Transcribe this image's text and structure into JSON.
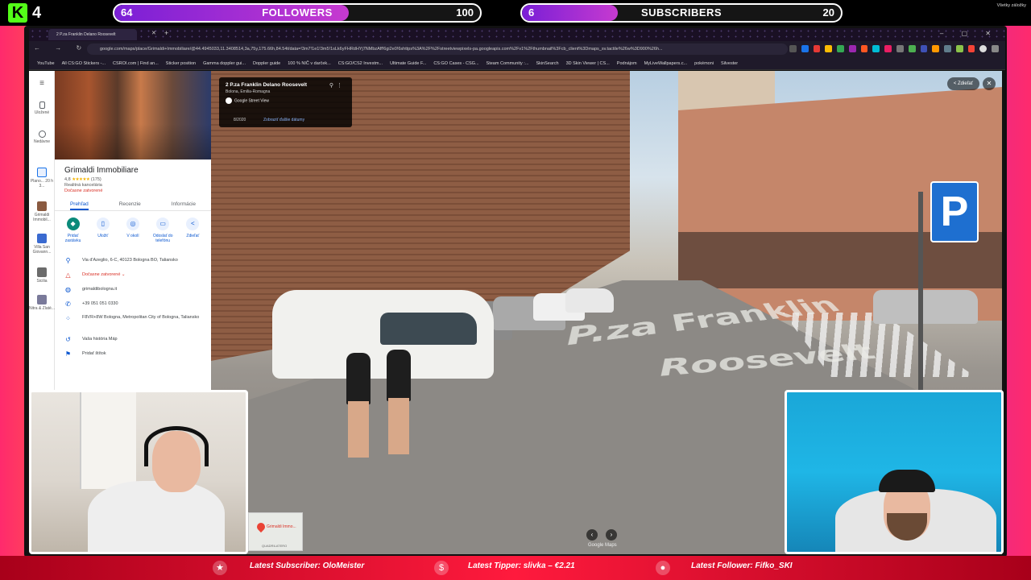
{
  "overlay": {
    "kick_count": "4",
    "followers_goal": {
      "current": "64",
      "label": "FOLLOWERS",
      "target": "100",
      "progress": 0.64
    },
    "subscribers_goal": {
      "current": "6",
      "label": "SUBSCRIBERS",
      "target": "20",
      "progress": 0.3
    }
  },
  "browser": {
    "tab_title": "2 P.za Franklin Delano Roosevelt",
    "url": "google.com/maps/place/Grimaldi+Immobiliare/@44.4945033,11.3408514,3a,75y,175.66h,84.54t/data=!3m7!1e1!3m5!1sLk6yFHRdHYj7NMbzAff!6gi2e0!6shttps%3A%2F%2Fstreetviewpixels-pa.googleapis.com%2Fv1%2Fthumbnail%3Fcb_client%3Dmaps_sv.tactile%26w%3D900%26h...",
    "bookmarks": [
      "YouTube",
      "All CS:GO Stickers -...",
      "CSROI.com | Find an...",
      "Sticker position",
      "Gamma doppler gui...",
      "Doppler guide",
      "100 % NIČ v darček...",
      "CS:GO/CS2 Investm...",
      "Ultimate Guide F...",
      "CS:GO Cases - CSG...",
      "Steam Community :...",
      "SkinSearch",
      "3D Skin Viewer | CS...",
      "Podnájom",
      "MyLiveWallpapers.c...",
      "pokémoni",
      "Silvester"
    ],
    "all_bookmarks": "Všetky záložky"
  },
  "rail": {
    "items": [
      {
        "label": "Uložené"
      },
      {
        "label": "Nedávne"
      },
      {
        "label": "Plano... 20 h 3..."
      },
      {
        "label": "Grimaldi Immobil..."
      },
      {
        "label": "Villa San Giovann..."
      },
      {
        "label": "Sicilia"
      },
      {
        "label": "Nitra & Zlaté..."
      }
    ]
  },
  "place": {
    "title": "Grimaldi Immobiliare",
    "rating": "4,8",
    "stars": "★★★★★",
    "reviews": "(175)",
    "category": "Realitná kancelária",
    "status": "Dočasne zatvorené",
    "tabs": [
      "Prehľad",
      "Recenzie",
      "Informácie"
    ],
    "actions": [
      "Pridať zastávku",
      "Uložiť",
      "V okolí",
      "Odoslať do telefónu",
      "Zdieľať"
    ],
    "address": "Via d'Azeglio, 6-C, 40123 Bologna BO, Taliansko",
    "hours": "Dočasne zatvorené",
    "website": "grimaldibologna.it",
    "phone": "+39 051 051 0330",
    "plus_code": "F8VR+8W Bologna, Metropolitan City of Bologna, Taliansko",
    "history": "Vaša história Máp",
    "label": "Pridať štítok"
  },
  "streetview": {
    "card_title": "2 P.za Franklin Delano Roosevelt",
    "card_sub": "Bolona, Emilia-Romagna",
    "card_source": "Google Street View",
    "card_date": "8/2020",
    "card_more": "Zobraziť ďalšie dátumy",
    "share_label": "Zdieľať",
    "road_text_1": "P.za Franklin",
    "road_text_2": "Roosevelt",
    "parking_sign": "P",
    "watermark": "Google Maps",
    "minimap_label": "Grimaldi Immo...",
    "minimap_area": "QUADRILATERO"
  },
  "ticker": {
    "subscriber": "Latest Subscriber: OloMeister",
    "tipper": "Latest Tipper: slivka – €2.21",
    "follower": "Latest Follower: Fifko_SKI"
  }
}
